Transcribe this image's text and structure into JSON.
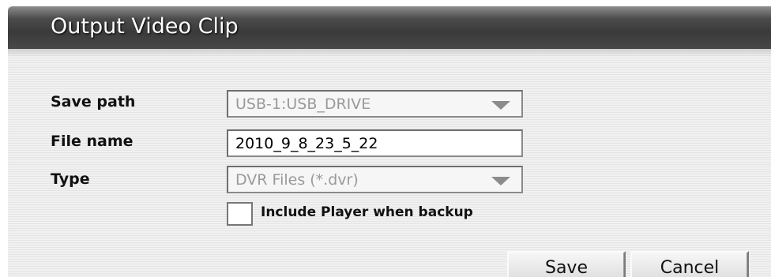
{
  "window": {
    "title": "Output Video Clip"
  },
  "form": {
    "save_path": {
      "label": "Save path",
      "value": "USB-1:USB_DRIVE"
    },
    "file_name": {
      "label": "File name",
      "value": "2010_9_8_23_5_22"
    },
    "type": {
      "label": "Type",
      "value": "DVR Files (*.dvr)"
    },
    "include_player": {
      "label": "Include Player when backup",
      "checked": false
    }
  },
  "buttons": {
    "save": "Save",
    "cancel": "Cancel"
  },
  "icons": {
    "dropdown": "chevron-down-icon"
  },
  "colors": {
    "titlebar": "#3a3a3a",
    "title_text": "#ffffff",
    "disabled_text": "#9a9a9a",
    "background": "#ebebeb"
  }
}
